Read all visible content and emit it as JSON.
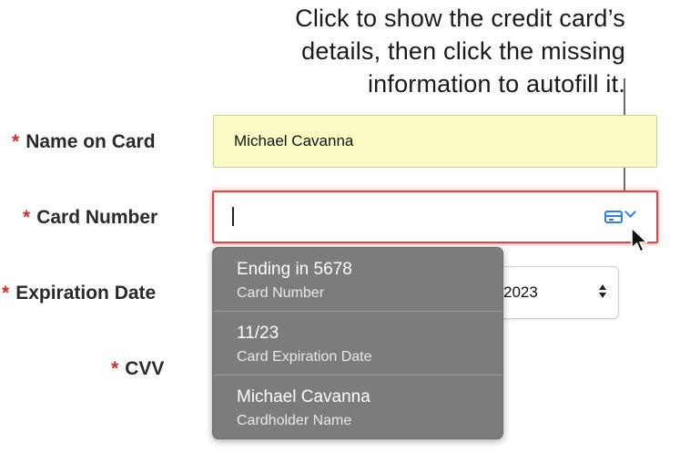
{
  "callout": {
    "line1": "Click to show the credit card’s",
    "line2": "details, then click the missing",
    "line3": "information to autofill it."
  },
  "form": {
    "required_marker": "*",
    "name_label": "Name on Card",
    "name_value": "Michael Cavanna",
    "card_number_label": "Card Number",
    "card_number_value": "",
    "expiration_label": "Expiration Date",
    "expiration_year_visible": "2023",
    "cvv_label": "CVV"
  },
  "autofill_menu": {
    "items": [
      {
        "title": "Ending in 5678",
        "subtitle": "Card Number"
      },
      {
        "title": "11/23",
        "subtitle": "Card Expiration Date"
      },
      {
        "title": "Michael Cavanna",
        "subtitle": "Cardholder Name"
      }
    ]
  },
  "icons": {
    "autofill_card": "credit-card-icon",
    "autofill_chevron": "chevron-down-icon",
    "select_arrows": "up-down-arrows-icon",
    "pointer": "mouse-pointer-icon"
  },
  "colors": {
    "required_star": "#d0312d",
    "autofilled_field_bg": "#fafcc4",
    "error_border": "#ef4040",
    "accent_blue": "#2f7cf6",
    "menu_bg": "#7c7c7c"
  }
}
